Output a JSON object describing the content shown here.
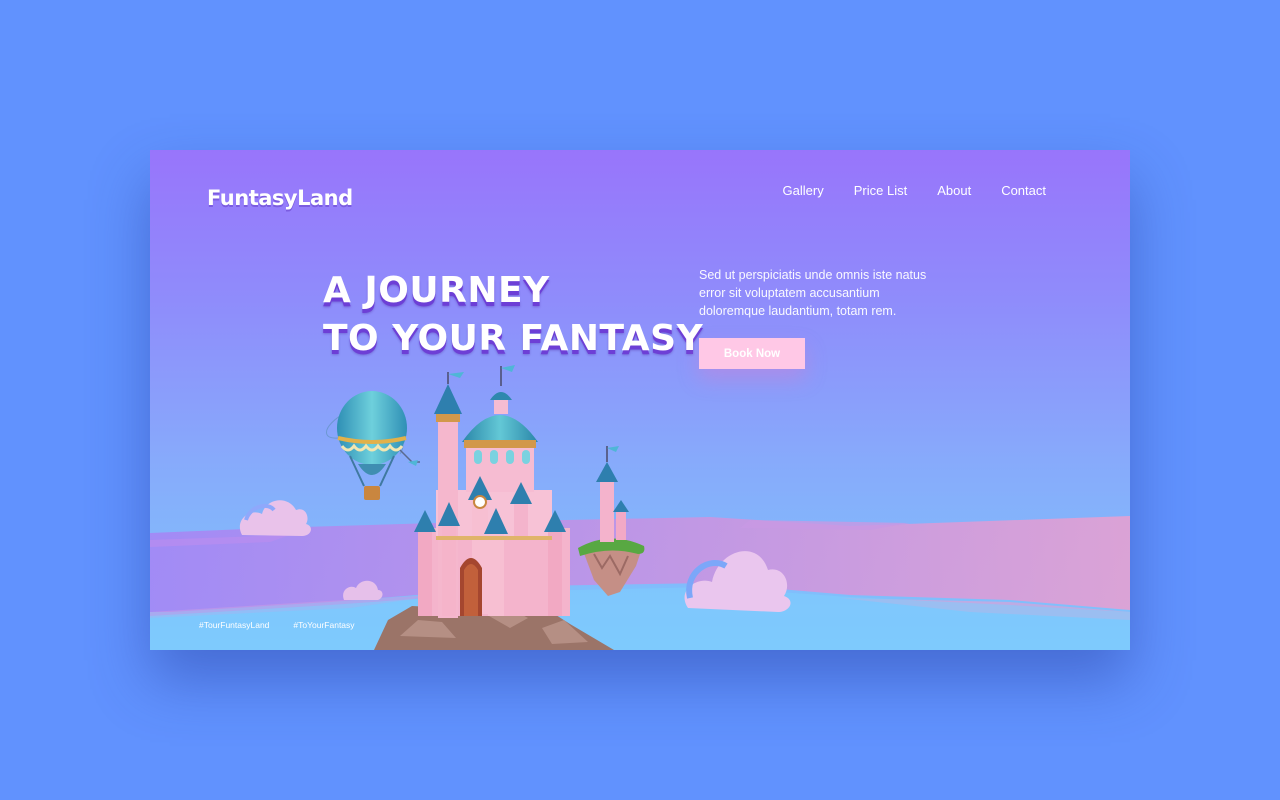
{
  "brand": {
    "logo": "FuntasyLand"
  },
  "nav": {
    "items": [
      {
        "label": "Gallery"
      },
      {
        "label": "Price List"
      },
      {
        "label": "About"
      },
      {
        "label": "Contact"
      }
    ]
  },
  "hero": {
    "headline_line1": "A JOURNEY",
    "headline_line2": "TO YOUR FANTASY",
    "description": "Sed ut perspiciatis unde omnis iste natus error sit voluptatem accusantium doloremque laudantium, totam rem.",
    "cta_label": "Book Now",
    "illustration": {
      "icons": [
        "hot-air-balloon-icon",
        "castle-icon",
        "cloud-icon",
        "floating-island-icon"
      ]
    }
  },
  "hashtags": [
    "#TourFuntasyLand",
    "#ToYourFantasy"
  ],
  "colors": {
    "page_background": "#6192fe",
    "gradient_top": "#9875fb",
    "gradient_bottom": "#7ec6fc",
    "cta_background": "#ffc8e6",
    "headline_shadow": "#6d3fd6"
  }
}
